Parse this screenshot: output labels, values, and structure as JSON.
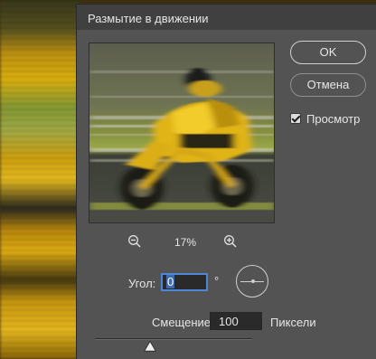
{
  "dialog": {
    "title": "Размытие в движении"
  },
  "buttons": {
    "ok_label": "OK",
    "cancel_label": "Отмена"
  },
  "preview_toggle": {
    "label": "Просмотр",
    "checked": true
  },
  "zoom": {
    "level": "17%",
    "zoom_out_icon": "zoom-out-icon",
    "zoom_in_icon": "zoom-in-icon"
  },
  "angle": {
    "label": "Угол:",
    "value": "0",
    "unit": "°",
    "dial_icon": "angle-dial-icon"
  },
  "distance": {
    "label": "Смещение:",
    "value": "100",
    "unit": "Пиксели",
    "slider_fraction": 0.1
  },
  "colors": {
    "dialog_bg": "#535353",
    "titlebar_bg": "#404040",
    "focus_border": "#4f87d8",
    "text": "#e6e6e6"
  }
}
